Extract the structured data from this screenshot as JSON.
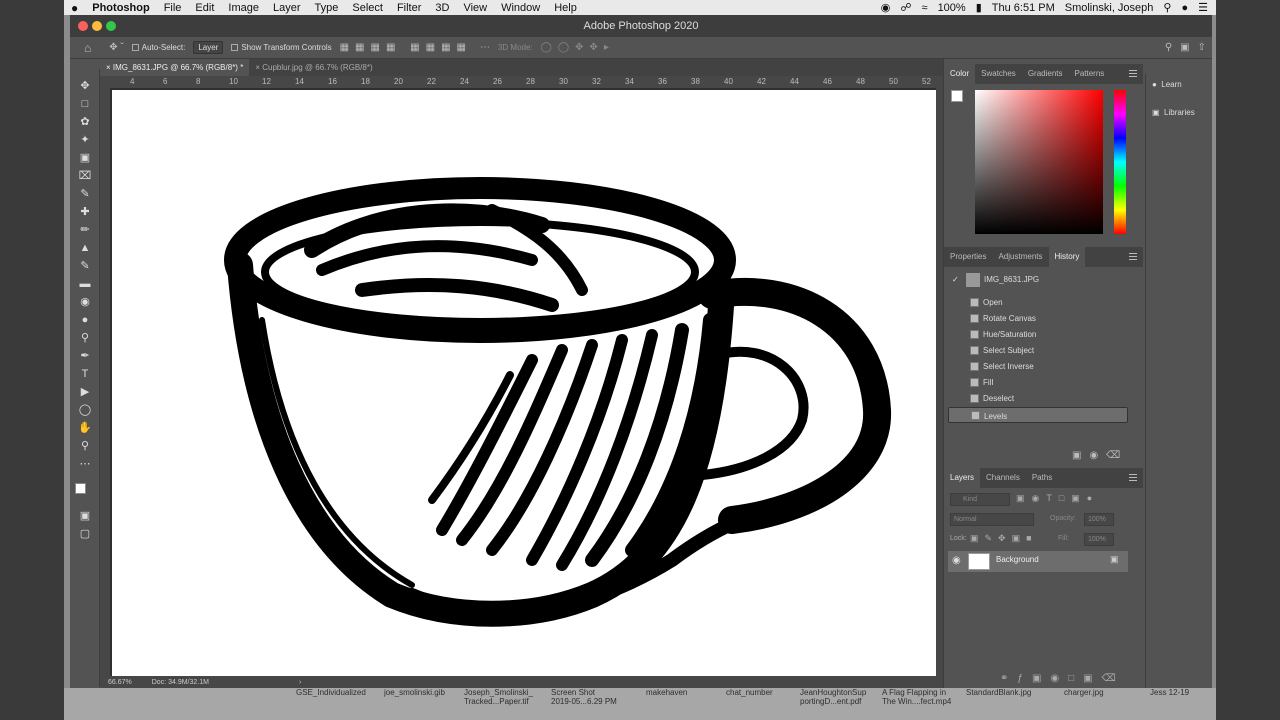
{
  "menubar": {
    "apple": "",
    "items": [
      "Photoshop",
      "File",
      "Edit",
      "Image",
      "Layer",
      "Type",
      "Select",
      "Filter",
      "3D",
      "View",
      "Window",
      "Help"
    ],
    "battery": "100%",
    "clock": "Thu 6:51 PM",
    "user": "Smolinski, Joseph"
  },
  "window": {
    "title": "Adobe Photoshop 2020"
  },
  "options": {
    "auto_select_label": "Auto-Select:",
    "auto_select_value": "Layer",
    "transform_label": "Show Transform Controls",
    "mode_3d": "3D Mode:"
  },
  "doc_tabs": [
    {
      "label": "IMG_8631.JPG @ 66.7% (RGB/8*) *"
    },
    {
      "label": "Cupblur.jpg @ 66.7% (RGB/8*)"
    }
  ],
  "ruler_marks": [
    "4",
    "6",
    "8",
    "10",
    "12",
    "14",
    "16",
    "18",
    "20",
    "22",
    "24",
    "26",
    "28",
    "30",
    "32",
    "34",
    "36",
    "38",
    "40",
    "42",
    "44",
    "46",
    "48",
    "50",
    "52"
  ],
  "status": {
    "zoom": "66.67%",
    "doc": "Doc: 34.9M/32.1M"
  },
  "color_panel": {
    "tabs": [
      "Color",
      "Swatches",
      "Gradients",
      "Patterns"
    ],
    "hue": "#ff0000"
  },
  "history_panel": {
    "tabs": [
      "Properties",
      "Adjustments",
      "History"
    ],
    "snapshot": "IMG_8631.JPG",
    "steps": [
      "Open",
      "Rotate Canvas",
      "Hue/Saturation",
      "Select Subject",
      "Select Inverse",
      "Fill",
      "Deselect",
      "Levels"
    ]
  },
  "layers_panel": {
    "tabs": [
      "Layers",
      "Channels",
      "Paths"
    ],
    "kind_placeholder": "Kind",
    "blend_mode": "Normal",
    "opacity_label": "Opacity:",
    "opacity": "100%",
    "lock_label": "Lock:",
    "fill_label": "Fill:",
    "fill": "100%",
    "layers": [
      {
        "name": "Background"
      }
    ]
  },
  "side_panel": {
    "learn": "Learn",
    "libraries": "Libraries"
  },
  "dock": {
    "items": [
      {
        "line1": "GSE_Individualized",
        "line2": ""
      },
      {
        "line1": "joe_smolinski.gib",
        "line2": ""
      },
      {
        "line1": "Joseph_Smolinski_",
        "line2": "Tracked...Paper.tif"
      },
      {
        "line1": "Screen Shot",
        "line2": "2019-05...6.29 PM"
      },
      {
        "line1": "makehaven",
        "line2": ""
      },
      {
        "line1": "chat_number",
        "line2": ""
      },
      {
        "line1": "JeanHoughtonSup",
        "line2": "portingD...ent.pdf"
      },
      {
        "line1": "A Flag Flapping in",
        "line2": "The Win....fect.mp4"
      },
      {
        "line1": "StandardBlank.jpg",
        "line2": ""
      },
      {
        "line1": "charger.jpg",
        "line2": ""
      },
      {
        "line1": "Jess 12-19",
        "line2": ""
      }
    ]
  }
}
